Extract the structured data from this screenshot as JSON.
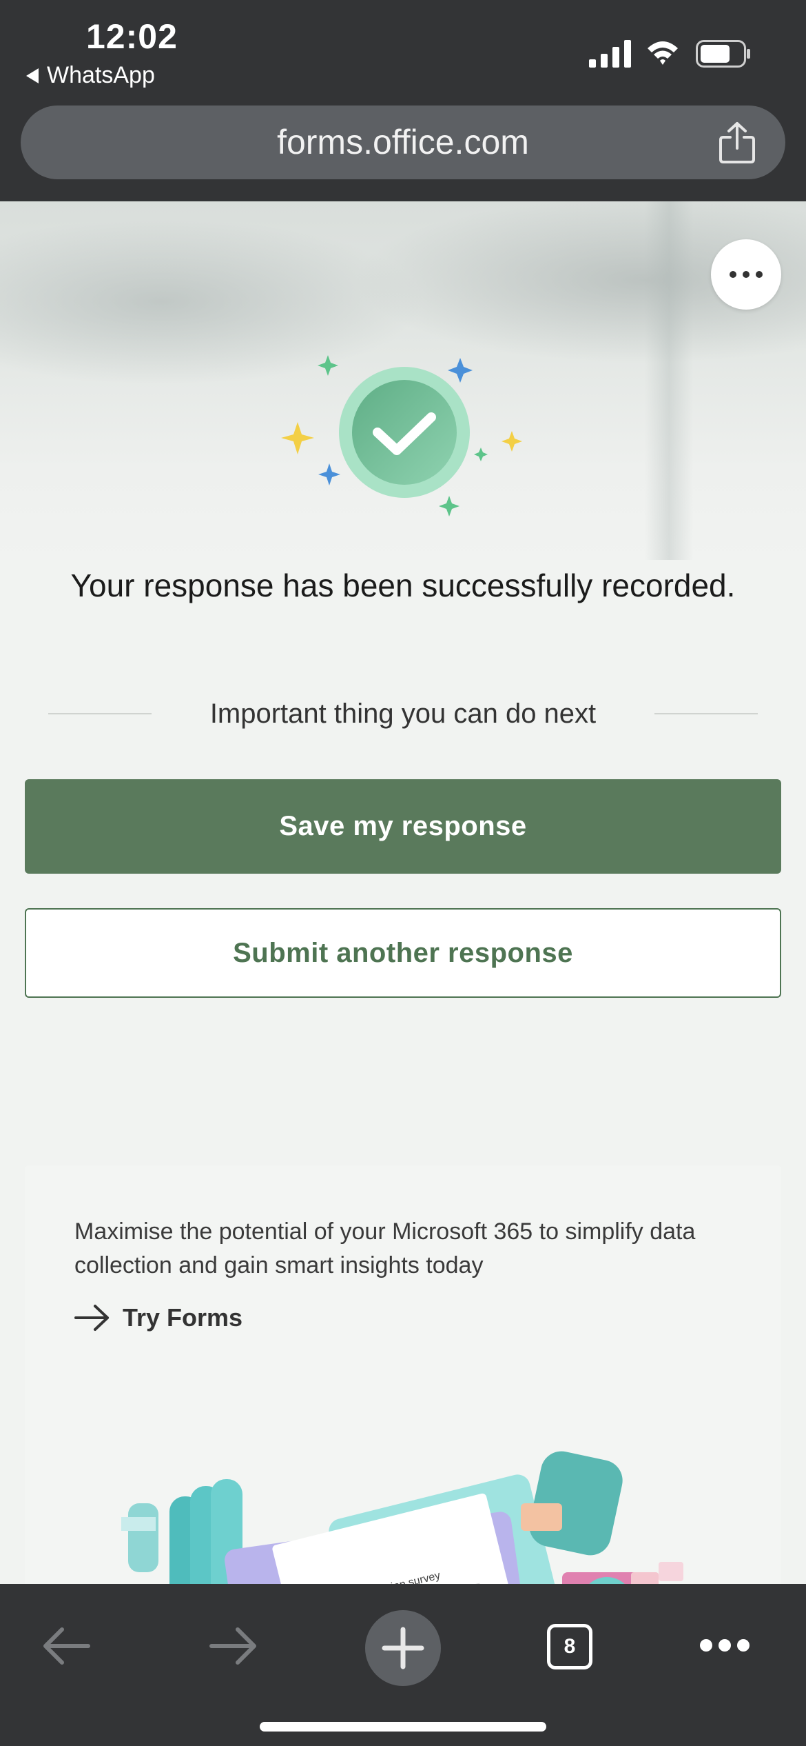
{
  "status_bar": {
    "time": "12:02",
    "back_app": "WhatsApp"
  },
  "browser": {
    "url": "forms.office.com",
    "tab_count": "8"
  },
  "page": {
    "success_message": "Your response has been successfully recorded.",
    "next_steps_title": "Important thing you can do next",
    "save_button": "Save my response",
    "submit_another_button": "Submit another response",
    "promo": {
      "text": "Maximise the potential of your Microsoft 365 to simplify data collection and gain smart insights today",
      "link_label": "Try Forms",
      "illustration_caption": "Customer expectation survey"
    }
  },
  "colors": {
    "primary_green": "#5a7a5c",
    "outline_green": "#4e7452",
    "chrome_dark": "#333436"
  }
}
